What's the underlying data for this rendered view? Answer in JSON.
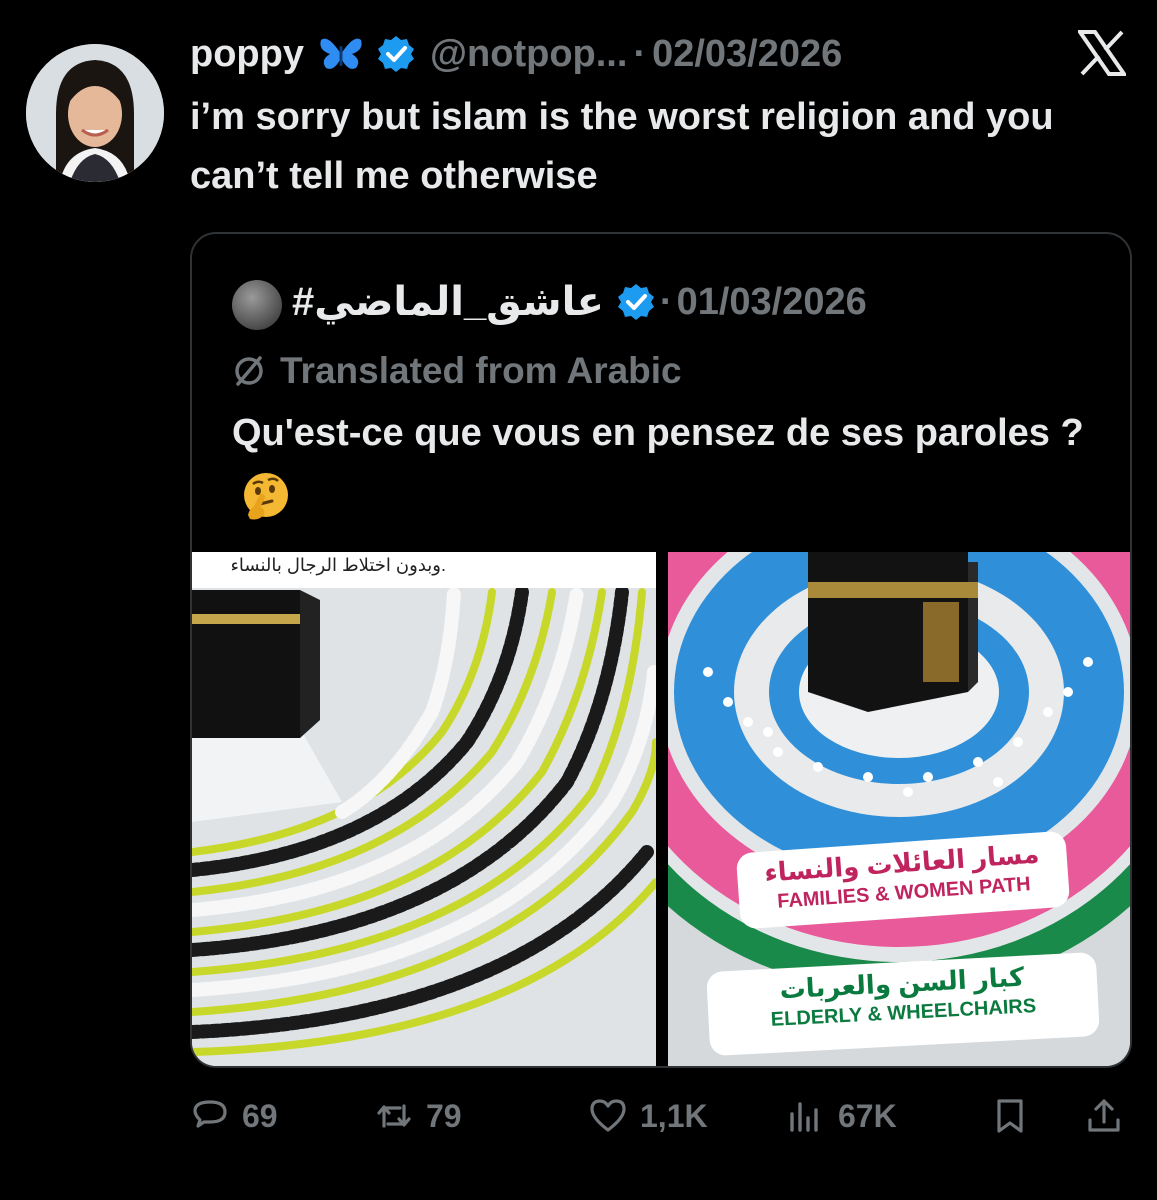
{
  "tweet": {
    "author_name": "poppy",
    "author_handle": "@notpop...",
    "separator": "·",
    "date": "02/03/2026",
    "text": "i’m sorry but islam is the worst religion and you can’t tell me otherwise",
    "verified": true,
    "name_emoji": "butterfly"
  },
  "quote": {
    "author_name": "#عاشق_الماضي",
    "separator": "·",
    "date": "01/03/2026",
    "verified": true,
    "translated_label": "Translated from Arabic",
    "text": "Qu'est-ce que vous en pensez de ses paroles ?",
    "emoji": "thinking-face",
    "media": {
      "left_caption": "وبدون اختلاط الرجال بالنساء.",
      "right_label_1_ar": "مسار العائلات والنساء",
      "right_label_1_en": "FAMILIES & WOMEN PATH",
      "right_label_2_ar": "كبار السن والعربات",
      "right_label_2_en": "ELDERLY & WHEELCHAIRS"
    }
  },
  "actions": {
    "replies": "69",
    "reposts": "79",
    "likes": "1,1K",
    "views": "67K"
  },
  "colors": {
    "background": "#000000",
    "text": "#e7e9ea",
    "muted": "#71767b",
    "verified_blue": "#1d9bf0",
    "border": "#2f3336"
  },
  "icons": [
    "x-logo-icon",
    "verified-badge-icon",
    "butterfly-icon",
    "translate-icon",
    "reply-icon",
    "repost-icon",
    "like-icon",
    "views-icon",
    "bookmark-icon",
    "share-icon"
  ]
}
